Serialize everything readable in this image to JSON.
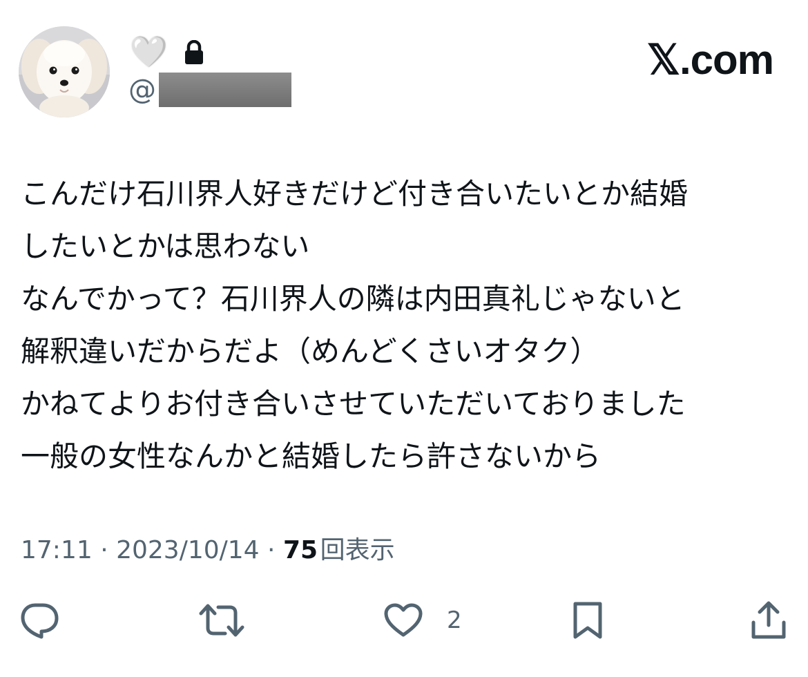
{
  "header": {
    "display_name_emoji": "🤍",
    "handle_prefix": "@",
    "brand": "𝕏.com"
  },
  "tweet": {
    "lines": [
      "こんだけ石川界人好きだけど付き合いたいとか結婚",
      "したいとかは思わない",
      "なんでかって？石川界人の隣は内田真礼じゃないと",
      "解釈違いだからだよ（めんどくさいオタク）",
      "かねてよりお付き合いさせていただいておりました",
      "一般の女性なんかと結婚したら許さないから"
    ]
  },
  "meta": {
    "time": "17:11",
    "separator": " · ",
    "date": "2023/10/14",
    "views_count": "75",
    "views_label": "回表示"
  },
  "actions": {
    "like_count": "2"
  },
  "icons": {
    "avatar": "dog-avatar",
    "lock": "lock-icon",
    "reply": "reply-icon",
    "retweet": "retweet-icon",
    "like": "heart-icon",
    "bookmark": "bookmark-icon",
    "share": "share-icon"
  },
  "colors": {
    "text": "#0f1419",
    "secondary": "#536471",
    "background": "#ffffff"
  }
}
